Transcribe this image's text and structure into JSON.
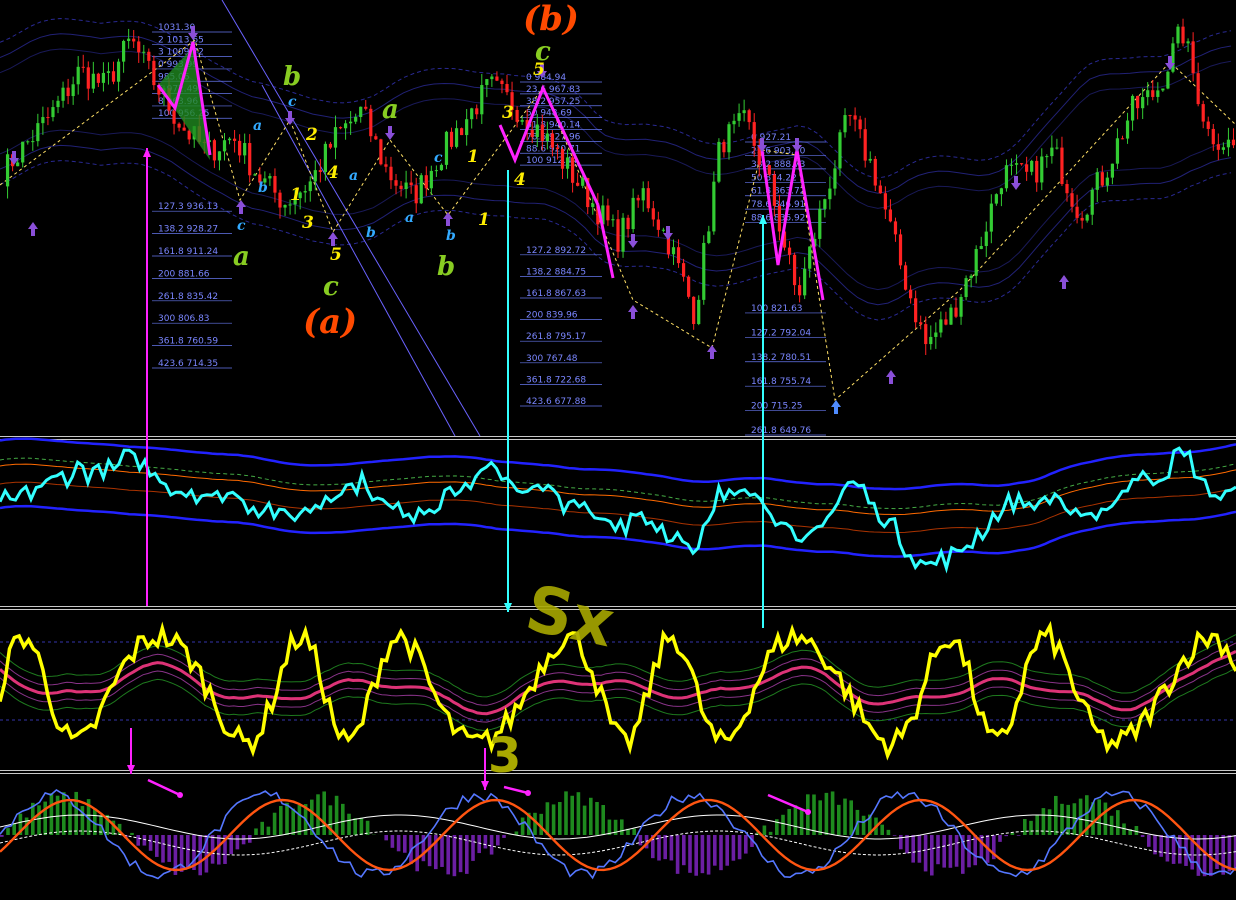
{
  "colors": {
    "background": "#000000",
    "bull": "#33cc33",
    "bear": "#ff2222",
    "fib": "#6677ee",
    "envelope": "#3b3bd0",
    "rsi": "#33ffff",
    "stoch": "#ffff00",
    "ma": "#dd3377",
    "macd_pos": "#1e8a1e",
    "macd_neg": "#6b1fa3",
    "signal": "#ff5511",
    "fast": "#5577ff",
    "arrow_magenta": "#ff22ff",
    "arrow_cyan": "#33ffff",
    "wave_big": "#ff4a00",
    "wave_major": "#88cc22",
    "wave_minor_yellow": "#ffee00",
    "wave_minor_cyan": "#33aaff"
  },
  "icons": [
    "fractal-down-arrow-icon",
    "fractal-up-arrow-icon",
    "vertical-arrow-icon"
  ],
  "fib_group_a": {
    "labels": [
      "1031.30",
      "2 1013.65",
      "3 1009.72",
      "0 993.99",
      "985.06",
      "5 972.49",
      "8 963.96",
      "100 956.25",
      "127.3 936.13",
      "138.2 928.27",
      "161.8 911.24",
      "200 881.66",
      "261.8 835.42",
      "300 806.83",
      "361.8 760.59",
      "423.6 714.35"
    ]
  },
  "fib_group_b": {
    "labels": [
      "0 984.94",
      "23.6 967.83",
      "38.2 957.25",
      "50 948.69",
      "61.8 940.14",
      "78.6 927.96",
      "88.6 920.71",
      "100 912.44",
      "127.2 892.72",
      "138.2 884.75",
      "161.8 867.63",
      "200 839.96",
      "261.8 795.17",
      "300 767.48",
      "361.8 722.68",
      "423.6 677.88"
    ]
  },
  "fib_group_c": {
    "labels": [
      "0 927.21",
      "23.6 903.20",
      "38.2 888.73",
      "50 874.22",
      "61.8 863.72",
      "78.6 846.91",
      "88.6 836.92",
      "100 821.63",
      "127.2 792.04",
      "138.2 780.51",
      "161.8 755.74",
      "200 715.25",
      "261.8 649.76"
    ]
  },
  "waves": {
    "big": [
      "(b)",
      "(a)"
    ],
    "major": [
      "b",
      "a",
      "c",
      "a",
      "b",
      "c"
    ],
    "minor_yellow": [
      "2",
      "1",
      "4",
      "3",
      "5",
      "1",
      "1",
      "3",
      "5",
      "4"
    ],
    "minor_cyan": [
      "c",
      "a",
      "b",
      "a",
      "b",
      "a",
      "c",
      "b",
      "c"
    ]
  },
  "annotations": {
    "sx": "Sx",
    "three": "3"
  },
  "chart_data": {
    "type": "line",
    "title": "",
    "panels": [
      "price",
      "oscillator",
      "stochastic",
      "macd-histogram"
    ],
    "price_points": [
      900,
      930,
      960,
      1000,
      985,
      1030,
      985,
      945,
      920,
      935,
      895,
      870,
      890,
      935,
      960,
      900,
      875,
      915,
      950,
      985,
      965,
      940,
      905,
      870,
      835,
      880,
      830,
      760,
      930,
      950,
      880,
      775,
      870,
      955,
      900,
      810,
      730,
      760,
      820,
      900,
      895,
      920,
      860,
      900,
      960,
      980,
      1040,
      940,
      925
    ],
    "fib_levels_a": [
      1031.3,
      993.99,
      956.25,
      936.13,
      928.27,
      911.24,
      881.66,
      835.42,
      806.83,
      760.59,
      714.35
    ],
    "fib_levels_b": [
      984.94,
      967.83,
      957.25,
      948.69,
      940.14,
      927.96,
      920.71,
      912.44,
      892.72,
      884.75,
      867.63,
      839.96,
      795.17,
      767.48,
      722.68,
      677.88
    ],
    "fib_levels_c": [
      927.21,
      903.2,
      888.73,
      874.22,
      863.72,
      846.91,
      836.92,
      821.63,
      792.04,
      780.51,
      755.74,
      715.25,
      649.76
    ]
  }
}
